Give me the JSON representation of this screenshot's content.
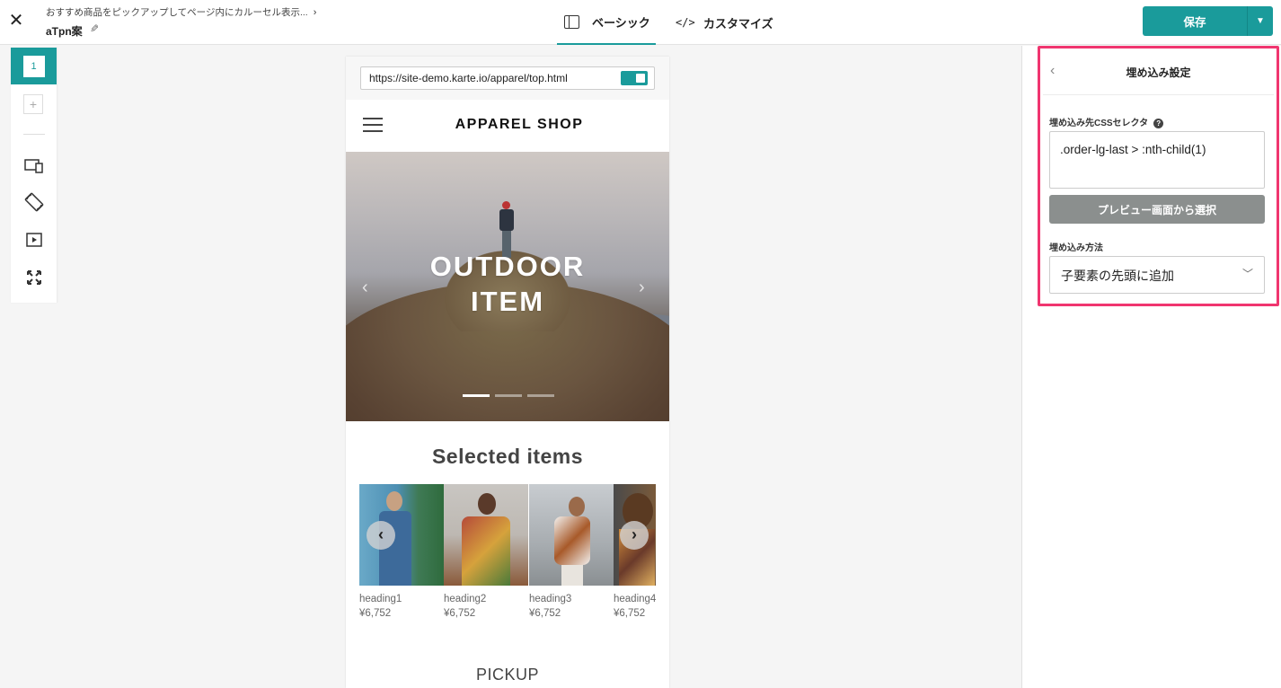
{
  "header": {
    "close_glyph": "✕",
    "breadcrumb": "おすすめ商品をピックアップしてページ内にカルーセル表示...",
    "variant_name": "aTpn案",
    "tabs": [
      {
        "label": "ベーシック",
        "icon": "panel-icon",
        "active": true
      },
      {
        "label": "カスタマイズ",
        "icon": "code-icon",
        "active": false
      }
    ],
    "save_label": "保存"
  },
  "toolbar": {
    "variant_number": "1",
    "add_label": "+",
    "icons": [
      "device-icon",
      "rotate-icon",
      "play-preview-icon",
      "fullscreen-icon"
    ]
  },
  "preview": {
    "url": "https://site-demo.karte.io/apparel/top.html",
    "shop_title": "APPAREL SHOP",
    "hero_line1": "OUTDOOR",
    "hero_line2": "ITEM",
    "selected_title": "Selected items",
    "items": [
      {
        "name": "heading1",
        "price": "¥6,752"
      },
      {
        "name": "heading2",
        "price": "¥6,752"
      },
      {
        "name": "heading3",
        "price": "¥6,752"
      },
      {
        "name": "heading4",
        "price": "¥6,752"
      }
    ],
    "pickup_title": "PICKUP"
  },
  "panel": {
    "title": "埋め込み設定",
    "selector_label": "埋め込み先CSSセレクタ",
    "selector_value": ".order-lg-last > :nth-child(1)",
    "pick_button": "プレビュー画面から選択",
    "method_label": "埋め込み方法",
    "method_value": "子要素の先頭に追加"
  },
  "colors": {
    "accent": "#1a9b9b",
    "highlight": "#f0356f"
  }
}
